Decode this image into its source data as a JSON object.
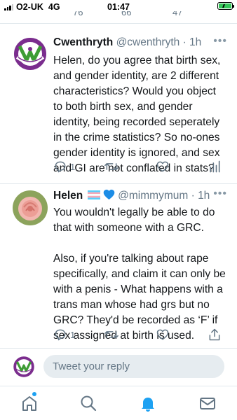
{
  "status_bar": {
    "carrier": "O2-UK",
    "network": "4G",
    "time": "01:47",
    "battery_color": "#34c759",
    "signal_bars": 3
  },
  "previous_tweet_actions": {
    "likes_partial": "76",
    "retweets_partial": "66",
    "other_partial": "47"
  },
  "tweets": [
    {
      "name": "Cwenthryth",
      "handle": "@cwenthryth",
      "separator": "·",
      "time": "1h",
      "body": "Helen, do you agree that birth sex, and gender identity, are 2 different characteristics? Would you object to both birth sex, and gender identity, being recorded seperately in the crime statistics? So no-ones gender identity is ignored, and sex and GI are not conflated in stats?",
      "reply_count": "1",
      "avatar_icon": "suffragette-women-won-wikipedia-logo",
      "actions": [
        "reply-icon",
        "retweet-icon",
        "like-icon",
        "analytics-icon"
      ]
    },
    {
      "name": "Helen",
      "name_emoji": [
        "transgender-flag-icon",
        "blue-heart-icon"
      ],
      "handle": "@mimmymum",
      "separator": "·",
      "time": "1h",
      "body": "You wouldn't legally be able to do that with someone with a GRC.\n\nAlso, if you're talking about rape specifically, and claim it can only be with a penis - What happens with a trans man whose had grs but no GRC? They'd be recorded as ‘F’ if sex assigned at birth is used.",
      "reply_count": "1",
      "avatar_icon": "pink-rose-avatar",
      "actions": [
        "reply-icon",
        "retweet-icon",
        "like-icon",
        "share-icon"
      ]
    }
  ],
  "reply_bar": {
    "placeholder": "Tweet your reply"
  },
  "tab_bar": {
    "tabs": [
      "home-icon",
      "search-icon",
      "notifications-icon",
      "messages-icon"
    ],
    "active": "notifications-icon",
    "accent": "#1da1f2",
    "icon_color": "#657786"
  }
}
